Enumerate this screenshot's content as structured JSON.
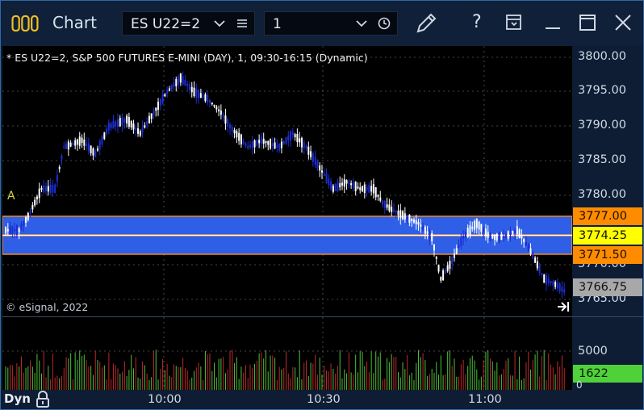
{
  "window": {
    "app_title": "Chart",
    "symbol_combo": "ES U22=2",
    "interval_combo": "1"
  },
  "chart": {
    "symbol_description": "* ES U22=2, S&P 500 FUTURES E-MINI (DAY), 1, 09:30-16:15 (Dynamic)",
    "copyright": "© eSignal, 2022",
    "marker_label": "A",
    "price_axis_labels": [
      "3800.00",
      "3795.00",
      "3790.00",
      "3785.00",
      "3780.00",
      "3770.00",
      "3765.00"
    ],
    "price_badges": {
      "upper": "3777.00",
      "middle": "3774.25",
      "lower": "3771.50",
      "last": "3766.75"
    },
    "volume_axis_label": "5000",
    "volume_badge": "1622",
    "time_labels": [
      "10:00",
      "10:30",
      "11:00"
    ],
    "dynamic_label": "Dyn",
    "colors": {
      "band_fill": "#2f5fe6",
      "band_border": "#f08a24",
      "up_candle": "#ffffff",
      "down_candle": "#1c2ed4",
      "volume_up": "#4fc03a",
      "volume_down": "#c0282a",
      "badge_orange": "#ff8c00",
      "badge_yellow": "#ffff00",
      "badge_gray": "#a8a8a8",
      "badge_green": "#4fd13a"
    }
  }
}
